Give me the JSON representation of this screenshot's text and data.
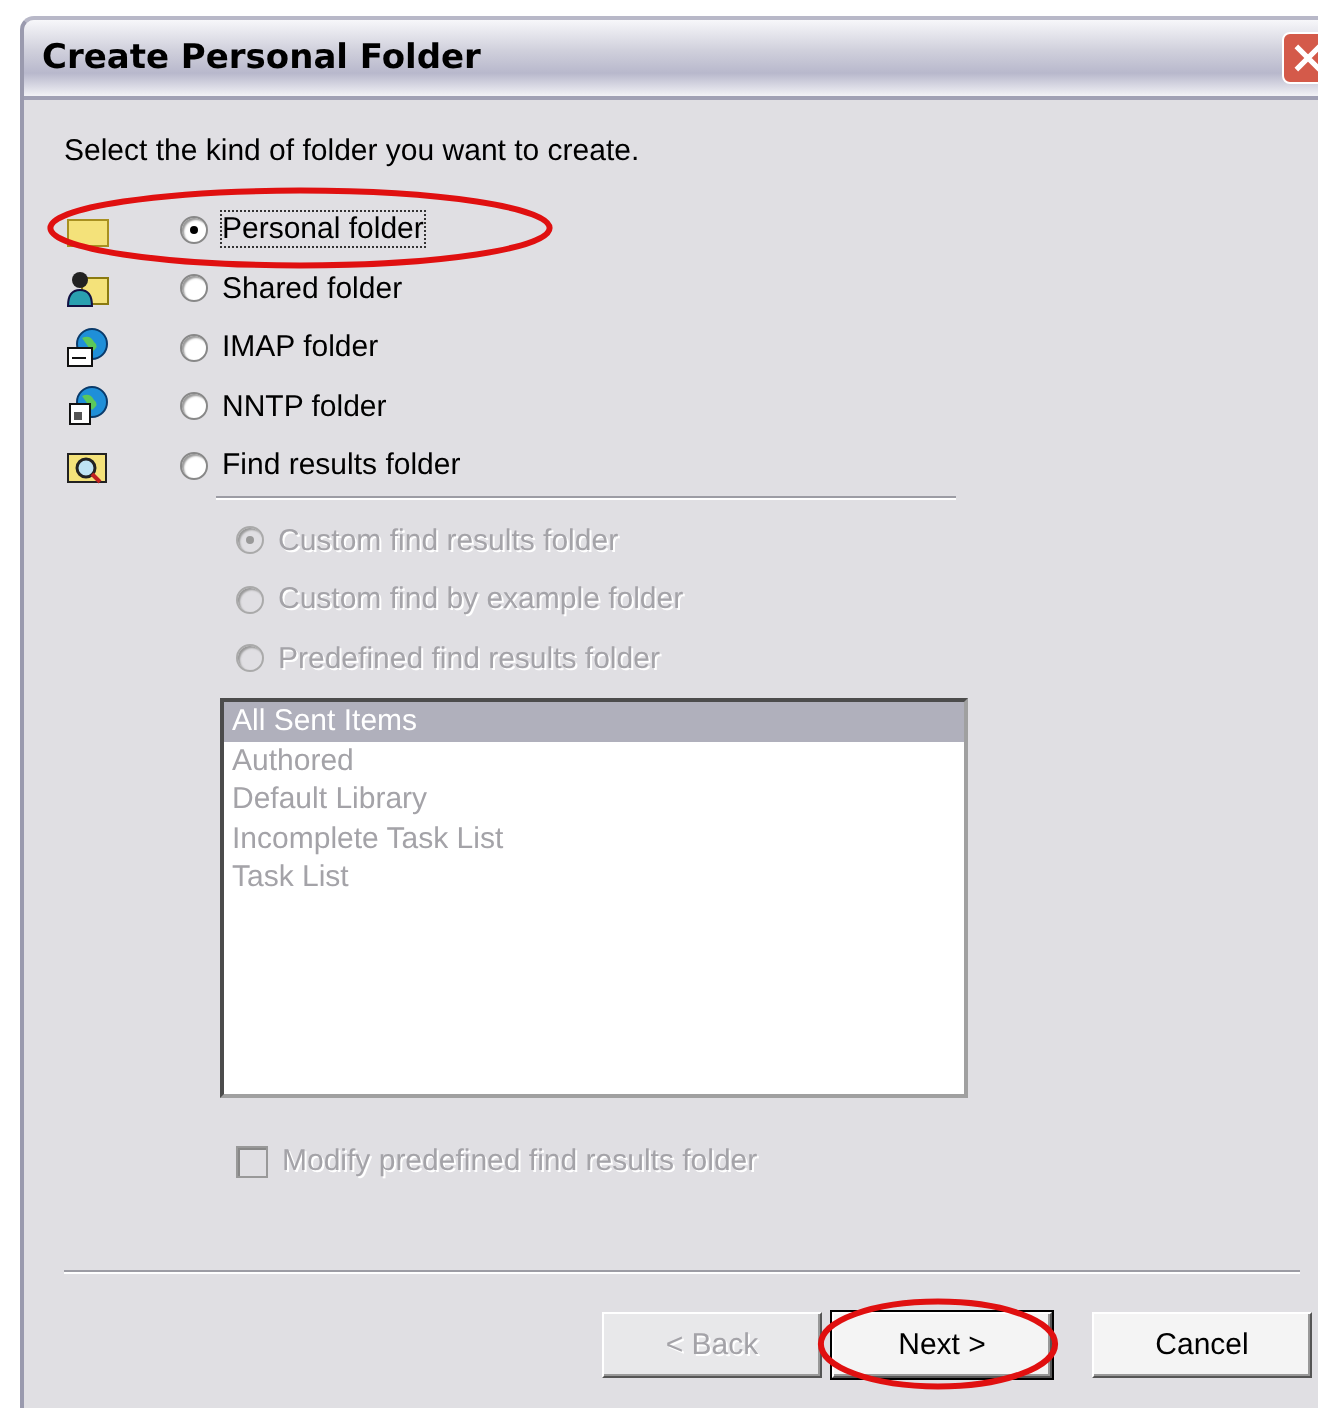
{
  "window": {
    "title": "Create Personal Folder"
  },
  "prompt": "Select the kind of folder you want to create.",
  "folder_types": [
    {
      "label": "Personal folder",
      "kind": "plain",
      "selected": true,
      "highlighted": true
    },
    {
      "label": "Shared folder",
      "kind": "shared",
      "selected": false,
      "highlighted": false
    },
    {
      "label": "IMAP folder",
      "kind": "imap",
      "selected": false,
      "highlighted": false
    },
    {
      "label": "NNTP folder",
      "kind": "nntp",
      "selected": false,
      "highlighted": false
    },
    {
      "label": "Find results folder",
      "kind": "find",
      "selected": false,
      "highlighted": false
    }
  ],
  "find_options": [
    {
      "label": "Custom find results folder",
      "selected": true,
      "disabled": true
    },
    {
      "label": "Custom find by example folder",
      "selected": false,
      "disabled": true
    },
    {
      "label": "Predefined find results folder",
      "selected": false,
      "disabled": true
    }
  ],
  "predefined_list": {
    "disabled": true,
    "items": [
      {
        "label": "All Sent Items",
        "selected": true
      },
      {
        "label": "Authored",
        "selected": false
      },
      {
        "label": "Default Library",
        "selected": false
      },
      {
        "label": "Incomplete Task List",
        "selected": false
      },
      {
        "label": "Task List",
        "selected": false
      }
    ]
  },
  "modify_checkbox": {
    "label": "Modify predefined find results folder",
    "checked": false,
    "disabled": true
  },
  "buttons": [
    {
      "label": "< Back",
      "disabled": true,
      "default": false,
      "highlighted": false
    },
    {
      "label": "Next >",
      "disabled": false,
      "default": true,
      "highlighted": true
    },
    {
      "label": "Cancel",
      "disabled": false,
      "default": false,
      "highlighted": false
    }
  ]
}
